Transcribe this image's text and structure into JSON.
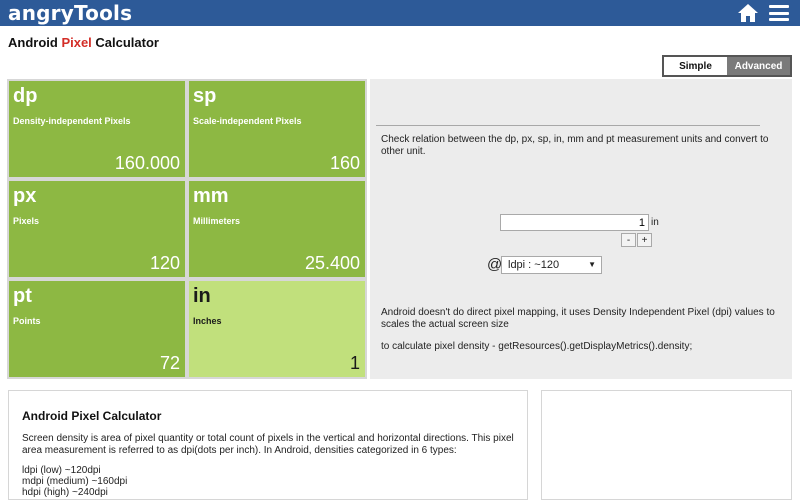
{
  "header": {
    "logo_text": "angryTools",
    "home_icon": "home-icon",
    "menu_icon": "hamburger-menu-icon",
    "bar_color": "#2d5a98"
  },
  "page": {
    "title_prefix": "Android ",
    "title_highlight": "Pixel",
    "title_suffix": " Calculator",
    "highlight_color": "#d32d27"
  },
  "mode_toggle": {
    "simple_label": "Simple",
    "advanced_label": "Advanced",
    "selected": "Simple"
  },
  "tiles": [
    {
      "unit": "dp",
      "name": "Density-independent Pixels",
      "value": "160.000",
      "active": false
    },
    {
      "unit": "sp",
      "name": "Scale-independent Pixels",
      "value": "160",
      "active": false
    },
    {
      "unit": "px",
      "name": "Pixels",
      "value": "120",
      "active": false
    },
    {
      "unit": "mm",
      "name": "Millimeters",
      "value": "25.400",
      "active": false
    },
    {
      "unit": "pt",
      "name": "Points",
      "value": "72",
      "active": false
    },
    {
      "unit": "in",
      "name": "Inches",
      "value": "1",
      "active": true
    }
  ],
  "tile_colors": {
    "normal": "#8db843",
    "active": "#c1e07c"
  },
  "converter": {
    "description": "Check relation between the dp, px, sp, in, mm and pt measurement units and convert to other unit.",
    "input_value": "1",
    "input_unit": "in",
    "minus_label": "-",
    "plus_label": "+",
    "at_sign": "@",
    "density_selected": "ldpi : ~120",
    "note_mapping": "Android doesn't do direct pixel mapping, it uses Density Independent Pixel (dpi) values to scales the actual screen size",
    "note_code": "to calculate pixel density - getResources().getDisplayMetrics().density;"
  },
  "article": {
    "title": "Android Pixel Calculator",
    "body": "Screen density is area of pixel quantity or total count of pixels in the vertical and horizontal directions. This pixel area measurement is referred to as dpi(dots per inch). In Android, densities categorized in 6 types:",
    "list": [
      "ldpi (low) ~120dpi",
      "mdpi (medium) ~160dpi",
      "hdpi (high) ~240dpi"
    ]
  }
}
